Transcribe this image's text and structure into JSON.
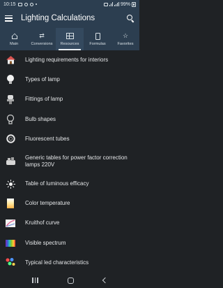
{
  "status": {
    "time": "10:15",
    "battery": "99%"
  },
  "app": {
    "title": "Lighting Calculations"
  },
  "tabs": [
    {
      "label": "Main",
      "icon": "home-icon"
    },
    {
      "label": "Conversions",
      "icon": "swap-icon"
    },
    {
      "label": "Resources",
      "icon": "grid-icon"
    },
    {
      "label": "Formulas",
      "icon": "book-icon"
    },
    {
      "label": "Favorites",
      "icon": "star-icon"
    }
  ],
  "active_tab": "Resources",
  "items": [
    {
      "label": "Lighting requirements for interiors",
      "icon": "house-icon"
    },
    {
      "label": "Types of lamp",
      "icon": "lamp-icon"
    },
    {
      "label": "Fittings of lamp",
      "icon": "fitting-icon"
    },
    {
      "label": "Bulb shapes",
      "icon": "bulb-icon"
    },
    {
      "label": "Fluorescent tubes",
      "icon": "tube-icon"
    },
    {
      "label": "Generic tables for power factor correction lamps 220V",
      "icon": "table-icon"
    },
    {
      "label": "Table of luminous efficacy",
      "icon": "sun-icon"
    },
    {
      "label": "Color temperature",
      "icon": "color-temperature-icon"
    },
    {
      "label": "Kruithof curve",
      "icon": "curve-icon"
    },
    {
      "label": "Visible spectrum",
      "icon": "spectrum-icon"
    },
    {
      "label": "Typical led characteristics",
      "icon": "led-icon"
    }
  ],
  "colors": {
    "bar": "#2c3e50",
    "background": "#1f2225",
    "text": "#e4e6e8"
  }
}
